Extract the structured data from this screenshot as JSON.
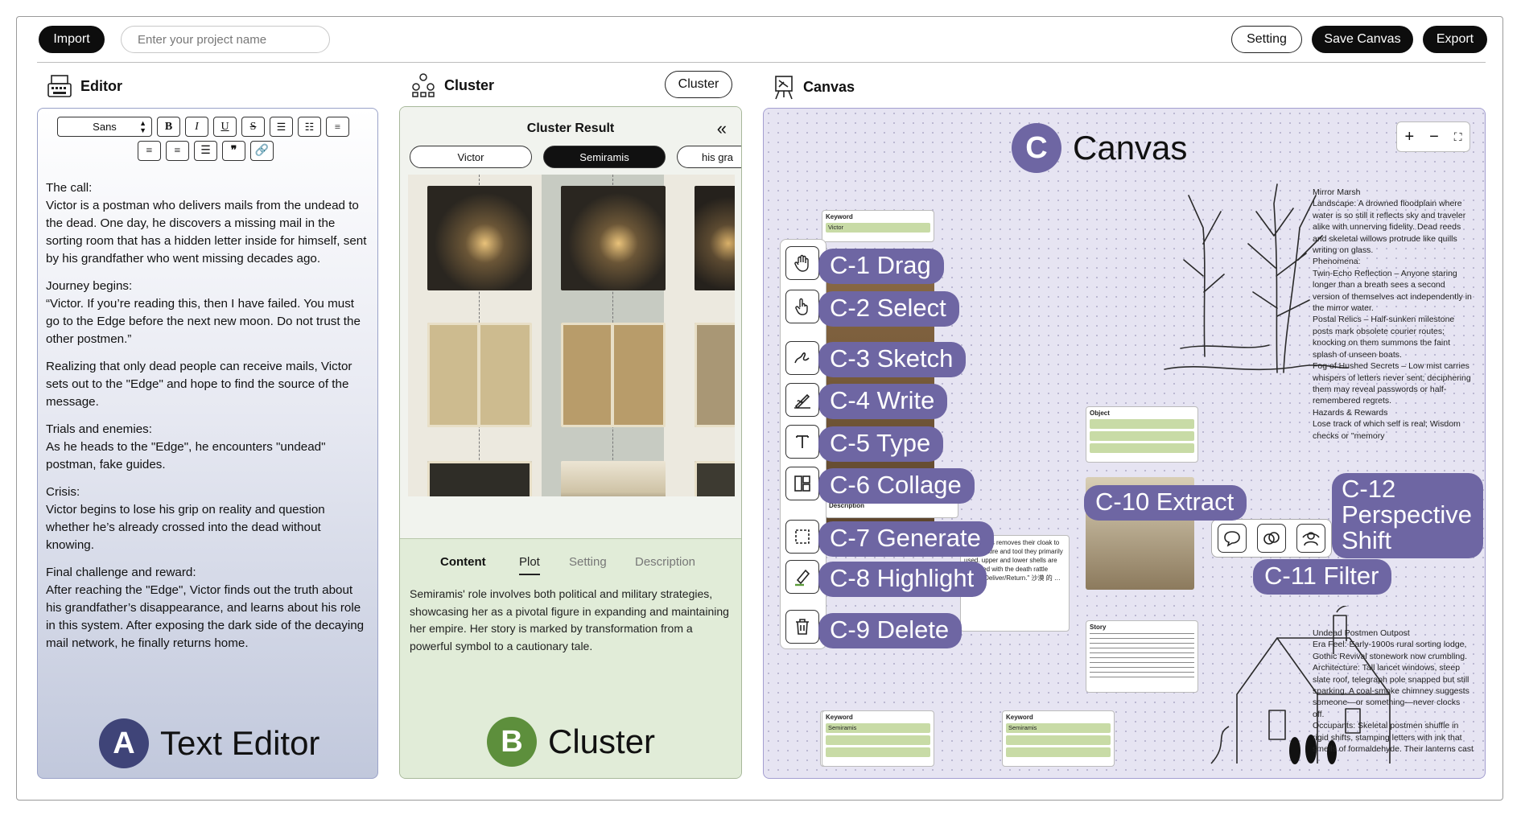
{
  "toolbar": {
    "import_label": "Import",
    "project_placeholder": "Enter your project name",
    "setting_label": "Setting",
    "save_label": "Save Canvas",
    "export_label": "Export"
  },
  "editor": {
    "header": "Editor",
    "font_value": "Sans",
    "paragraphs": [
      "The call:\nVictor is a postman who delivers mails from the undead to the dead. One day, he discovers a missing mail in the sorting room that has a hidden letter inside for himself, sent by his grandfather who went missing decades ago.",
      "Journey begins:\n“Victor. If you’re reading this, then I have failed. You must go to the Edge before the next new moon. Do not trust the other postmen.”",
      "Realizing that only dead people can receive mails, Victor sets out to the \"Edge\" and hope to find the source of the message.",
      "Trials and enemies:\nAs he heads to the \"Edge\", he encounters \"undead\" postman, fake guides.",
      "Crisis:\nVictor begins to lose his grip on reality and question whether he’s already crossed into the dead without knowing.",
      "Final challenge and reward:\nAfter reaching the \"Edge\", Victor finds out the truth about his grandfather’s disappearance, and learns about his role in this system. After exposing the dark side of the decaying mail network, he finally returns home."
    ],
    "badge_letter": "A",
    "panel_label": "Text Editor"
  },
  "cluster": {
    "header": "Cluster",
    "cluster_button": "Cluster",
    "result_title": "Cluster Result",
    "collapse_glyph": "«",
    "chips": [
      "Victor",
      "Semiramis",
      "his gra"
    ],
    "tabs": [
      "Content",
      "Plot",
      "Setting",
      "Description"
    ],
    "description": "Semiramis' role involves both political and military strategies, showcasing her as a pivotal figure in expanding and maintaining her empire. Her story is marked by transformation from a powerful symbol to a cautionary tale.",
    "badge_letter": "B",
    "panel_label": "Cluster"
  },
  "canvas": {
    "header": "Canvas",
    "badge_letter": "C",
    "panel_label": "Canvas",
    "zoom": {
      "plus": "+",
      "minus": "−",
      "fit": "⛶"
    },
    "callouts": [
      "C-1 Drag",
      "C-2 Select",
      "C-3 Sketch",
      "C-4 Write",
      "C-5 Type",
      "C-6 Collage",
      "C-7 Generate",
      "C-8 Highlight",
      "C-9 Delete",
      "C-10 Extract",
      "C-11 Filter",
      "C-12\nPerspective\nShift"
    ],
    "card_keyword_label": "Keyword",
    "card_victor": "Victor",
    "card_semiramis": "Semiramis",
    "card_object_label": "Object",
    "card_description_label": "Description",
    "card_story_label": "Story",
    "mirror_marsh": "Mirror Marsh\nLandscape: A drowned floodplain where water is so still it reflects sky and traveler alike with unnerving fidelity. Dead reeds and skeletal willows protrude like quills writing on glass.\nPhenomena:\nTwin-Echo Reflection – Anyone staring longer than a breath sees a second version of themselves act independently in the mirror water.\nPostal Relics – Half-sunken milestone posts mark obsolete courier routes; knocking on them summons the faint splash of unseen boats.\nFog of Hushed Secrets – Low mist carries whispers of letters never sent; deciphering them may reveal passwords or half-remembered regrets.\nHazards & Rewards\nLose track of which self is real; Wisdom checks or \"memory",
    "outpost": "Undead Postmen Outpost\nEra Feel: Early-1900s rural sorting lodge, Gothic Revival stonework now crumbling.\nArchitecture: Tall lancet windows, steep slate roof, telegraph pole snapped but still sparking. A coal-smoke chimney suggests someone—or something—never clocks off.\nOccupants: Skeletal postmen shuffle in rigid shifts, stamping letters with ink that smells of formaldehyde. Their lanterns cast",
    "desc_snippet": "Semiramis removes their cloak to formal attire and tool they primarily used. upper and lower shells are inscribed with the death rattle runes \"Deliver/Return.\" 沙漠 的 …"
  },
  "colors": {
    "badge_a": "#3f4478",
    "badge_b": "#5d8f3c",
    "badge_c": "#6e66a3",
    "callout": "#6e66a3"
  }
}
